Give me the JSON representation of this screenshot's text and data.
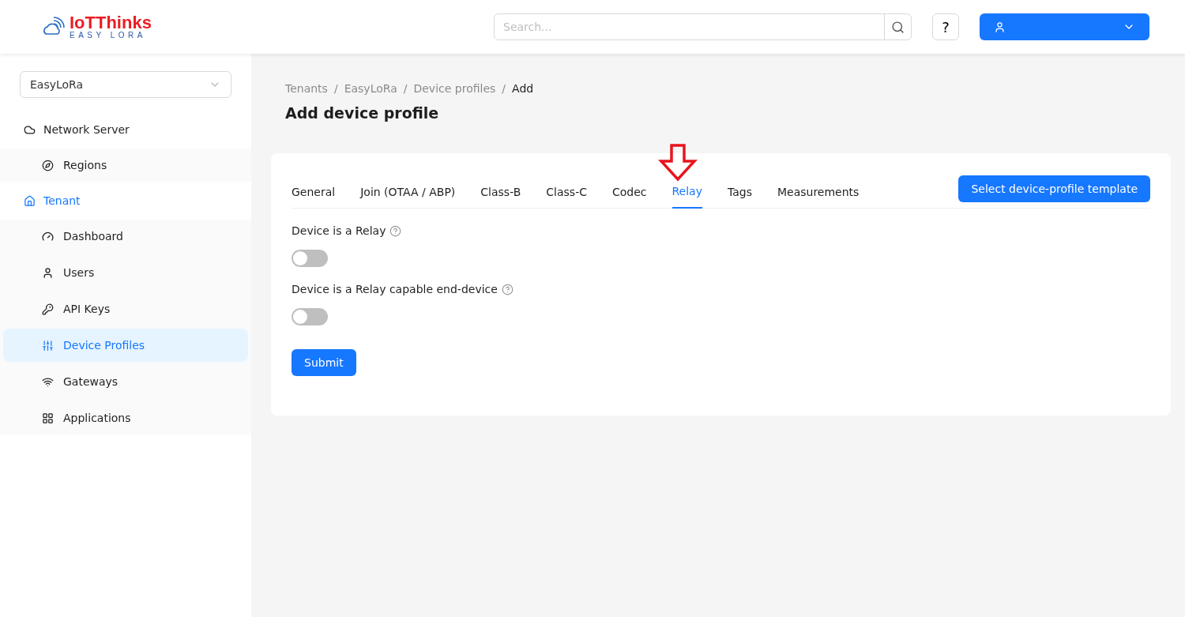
{
  "logo": {
    "name": "IoTThinks",
    "tagline": "EASY LORA"
  },
  "search": {
    "placeholder": "Search..."
  },
  "help_button": {
    "label": "?"
  },
  "tenant_select": {
    "value": "EasyLoRa"
  },
  "sidebar": {
    "groups": [
      {
        "label": "Network Server",
        "selected": false,
        "children": [
          {
            "label": "Regions",
            "selected": false
          }
        ]
      },
      {
        "label": "Tenant",
        "selected": true,
        "children": [
          {
            "label": "Dashboard",
            "selected": false
          },
          {
            "label": "Users",
            "selected": false
          },
          {
            "label": "API Keys",
            "selected": false
          },
          {
            "label": "Device Profiles",
            "selected": true
          },
          {
            "label": "Gateways",
            "selected": false
          },
          {
            "label": "Applications",
            "selected": false
          }
        ]
      }
    ]
  },
  "breadcrumb": [
    "Tenants",
    "/",
    "EasyLoRa",
    "/",
    "Device profiles",
    "/",
    "Add"
  ],
  "page_title": "Add device profile",
  "tabs": [
    {
      "label": "General",
      "selected": false
    },
    {
      "label": "Join (OTAA / ABP)",
      "selected": false
    },
    {
      "label": "Class-B",
      "selected": false
    },
    {
      "label": "Class-C",
      "selected": false
    },
    {
      "label": "Codec",
      "selected": false
    },
    {
      "label": "Relay",
      "selected": true
    },
    {
      "label": "Tags",
      "selected": false
    },
    {
      "label": "Measurements",
      "selected": false
    }
  ],
  "template_button": "Select device-profile template",
  "fields": [
    {
      "label": "Device is a Relay",
      "on": false
    },
    {
      "label": "Device is a Relay capable end-device",
      "on": false
    }
  ],
  "submit_button": "Submit"
}
